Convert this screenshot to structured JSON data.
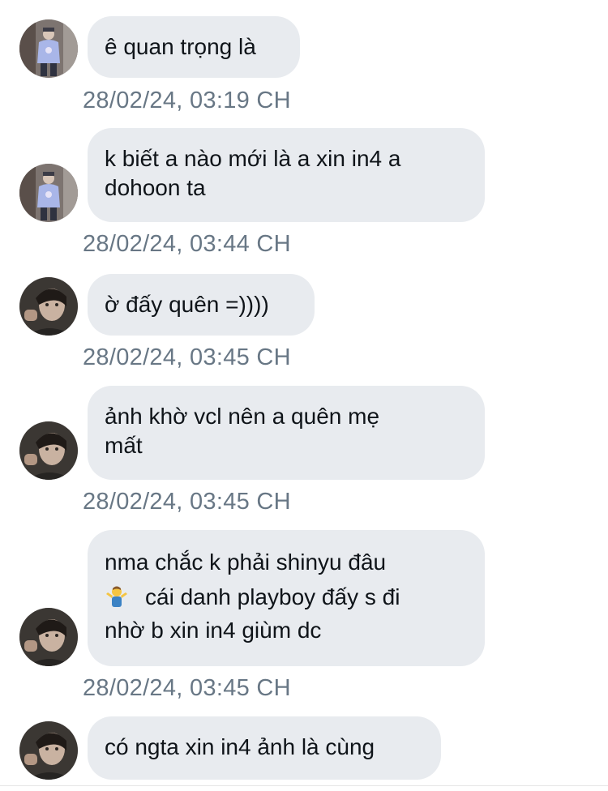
{
  "messages": [
    {
      "sender": "a",
      "lines": [
        "ê quan trọng là"
      ],
      "time": "28/02/24, 03:19 CH"
    },
    {
      "sender": "a",
      "lines": [
        "k biết a nào mới là a xin in4 a",
        "dohoon ta"
      ],
      "time": "28/02/24, 03:44 CH"
    },
    {
      "sender": "b",
      "lines": [
        "ờ đấy quên =))))"
      ],
      "time": "28/02/24, 03:45 CH"
    },
    {
      "sender": "b",
      "lines": [
        "ảnh khờ vcl nên a quên mẹ",
        "mất"
      ],
      "time": "28/02/24, 03:45 CH"
    },
    {
      "sender": "b",
      "lines": [
        "nma chắc k phải shinyu đâu",
        "cái danh playboy đấy s đi",
        "nhờ b xin in4 giùm dc"
      ],
      "emoji": "person-shrugging-icon",
      "time": "28/02/24, 03:45 CH"
    },
    {
      "sender": "b",
      "lines": [
        "có ngta xin in4 ảnh là cùng"
      ]
    }
  ],
  "colors": {
    "bubble_bg": "#e8ebef",
    "text": "#0f1419",
    "timestamp": "#687785"
  }
}
